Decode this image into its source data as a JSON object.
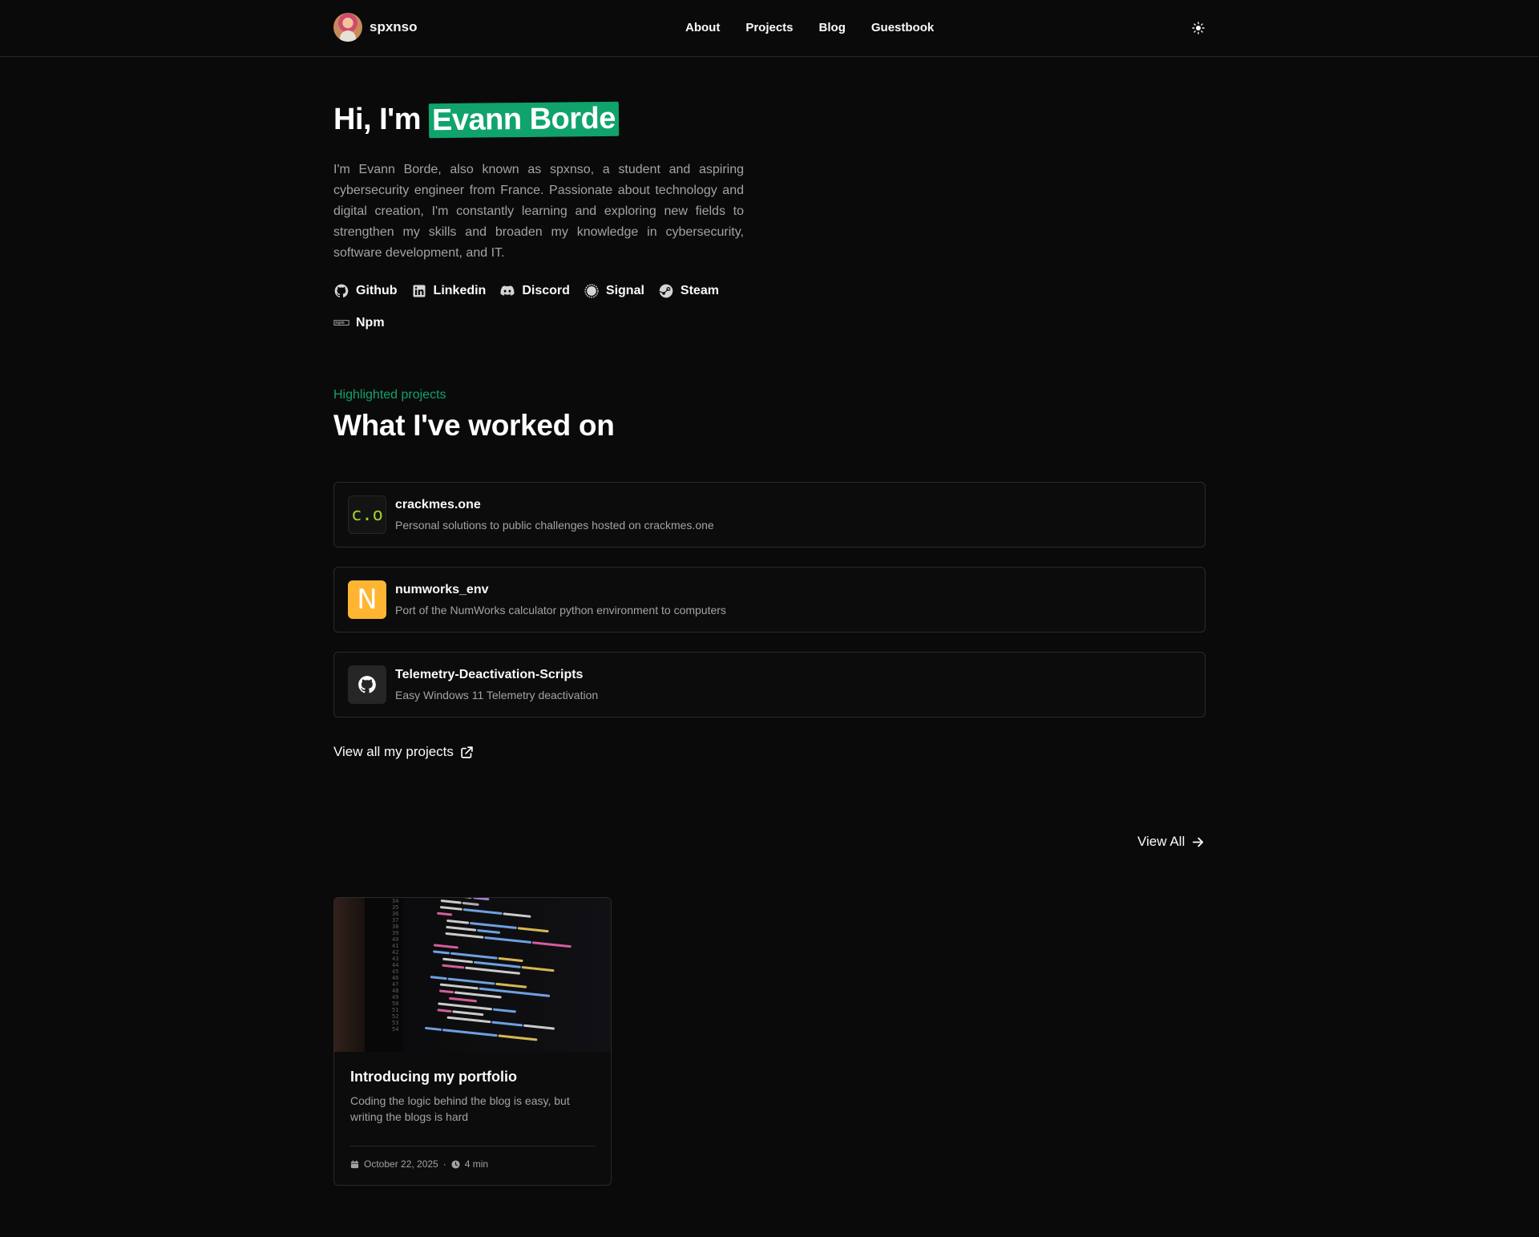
{
  "header": {
    "brand_name": "spxnso",
    "nav": [
      "About",
      "Projects",
      "Blog",
      "Guestbook"
    ]
  },
  "hero": {
    "greeting": "Hi, I'm",
    "name": "Evann Borde",
    "description": "I'm Evann Borde, also known as spxnso, a student and aspiring cybersecurity engineer from France. Passionate about technology and digital creation, I'm constantly learning and exploring new fields to strengthen my skills and broaden my knowledge in cybersecurity, software development, and IT.",
    "socials": [
      {
        "label": "Github",
        "icon": "github-icon"
      },
      {
        "label": "Linkedin",
        "icon": "linkedin-icon"
      },
      {
        "label": "Discord",
        "icon": "discord-icon"
      },
      {
        "label": "Signal",
        "icon": "signal-icon"
      },
      {
        "label": "Steam",
        "icon": "steam-icon"
      },
      {
        "label": "Npm",
        "icon": "npm-icon"
      }
    ]
  },
  "projects": {
    "eyebrow": "Highlighted projects",
    "title": "What I've worked on",
    "items": [
      {
        "logo_text": "c.o",
        "title": "crackmes.one",
        "description": "Personal solutions to public challenges hosted on crackmes.one"
      },
      {
        "logo_text": "N",
        "title": "numworks_env",
        "description": "Port of the NumWorks calculator python environment to computers"
      },
      {
        "logo_text": "",
        "title": "Telemetry-Deactivation-Scripts",
        "description": "Easy Windows 11 Telemetry deactivation"
      }
    ],
    "view_all_label": "View all my projects"
  },
  "blog": {
    "view_all_label": "View All",
    "posts": [
      {
        "title": "Introducing my portfolio",
        "description": "Coding the logic behind the blog is easy, but writing the blogs is hard",
        "date": "October 22, 2025",
        "separator": "·",
        "read_time": "4 min"
      }
    ]
  },
  "colors": {
    "accent": "#10a36b",
    "background": "#0a0a0a",
    "muted_text": "#a3a3a3",
    "border": "#2a2a2a",
    "numworks_logo": "#ffb531",
    "crackmes_logo_text": "#a3d12a"
  }
}
